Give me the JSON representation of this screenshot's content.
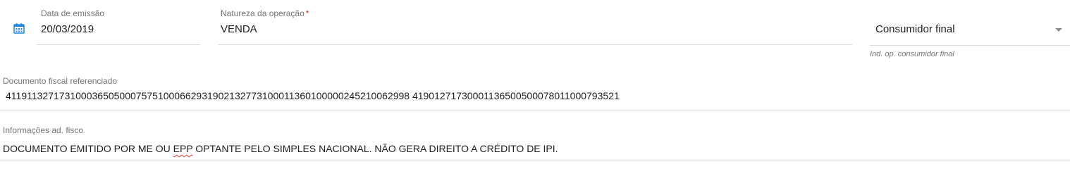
{
  "data_emissao": {
    "label": "Data de emissão",
    "value": "20/03/2019",
    "icon": "calendar-icon",
    "icon_color": "#1e88e5"
  },
  "natureza_operacao": {
    "label": "Natureza da operação",
    "required_marker": "*",
    "value": "VENDA"
  },
  "consumidor_final": {
    "value": "Consumidor final",
    "hint": "Ind. op. consumidor final"
  },
  "documento_fiscal": {
    "label": "Documento fiscal referenciado",
    "value": "41191132717310003650500075751000662931902132773100011360100000245210062998 41901271730001136500500078011000793521"
  },
  "informacoes_fisco": {
    "label": "Informações ad. fisco",
    "value_before": "DOCUMENTO EMITIDO POR ME OU ",
    "value_flagged": "EPP",
    "value_after": " OPTANTE PELO SIMPLES NACIONAL. NÃO GERA DIREITO A CRÉDITO DE IPI."
  }
}
